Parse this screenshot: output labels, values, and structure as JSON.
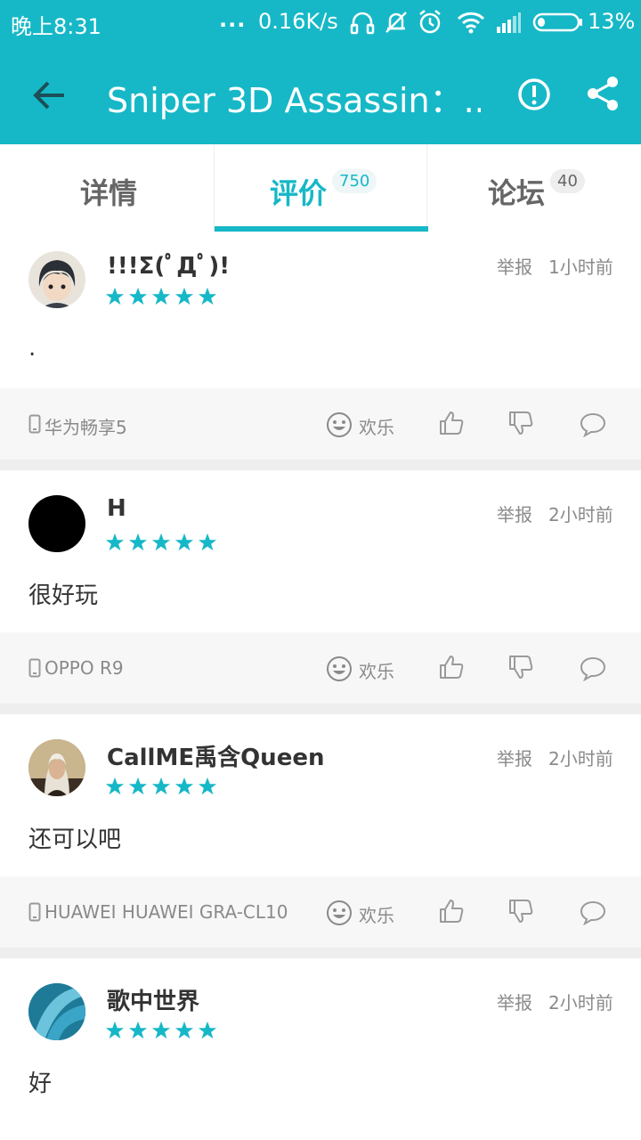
{
  "status_bar": {
    "time": "晚上8:31",
    "dots": "...",
    "speed": "0.16K/s",
    "battery": "13%",
    "icons": [
      "headset-icon",
      "mute-bell-icon",
      "alarm-icon",
      "wifi-icon",
      "signal-icon",
      "battery-icon"
    ]
  },
  "app_bar": {
    "title": "Sniper 3D Assassin：...",
    "back_icon": "arrow-left-icon",
    "report_icon": "exclamation-circle-icon",
    "share_icon": "share-icon"
  },
  "tabs": [
    {
      "label": "详情",
      "badge": ""
    },
    {
      "label": "评价",
      "badge": "750",
      "active": true
    },
    {
      "label": "论坛",
      "badge": "40"
    }
  ],
  "accent_color": "#16b8c7",
  "reviews": [
    {
      "username": "!!!Σ(ﾟДﾟ)!",
      "rating": 5,
      "report": "举报",
      "time": "1小时前",
      "content": ".",
      "device": "华为畅享5",
      "mood": "欢乐"
    },
    {
      "username": "H",
      "rating": 5,
      "report": "举报",
      "time": "2小时前",
      "content": "很好玩",
      "device": "OPPO R9",
      "mood": "欢乐"
    },
    {
      "username": "CallME禹含Queen",
      "rating": 5,
      "report": "举报",
      "time": "2小时前",
      "content": "还可以吧",
      "device": "HUAWEI HUAWEI GRA-CL10",
      "mood": "欢乐"
    },
    {
      "username": "歌中世界",
      "rating": 5,
      "report": "举报",
      "time": "2小时前",
      "content": "好"
    }
  ]
}
